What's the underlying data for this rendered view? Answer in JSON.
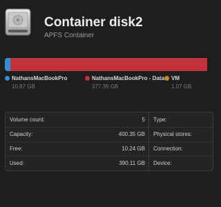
{
  "header": {
    "title": "Container disk2",
    "subtitle": "APFS Container",
    "icon": "hard-drive-icon"
  },
  "usage": {
    "segments": [
      {
        "name": "NathansMacBookPro",
        "size": "10.87 GB",
        "color": "#2f8fd6",
        "fraction": 0.027
      },
      {
        "name": "NathansMacBookPro - Data",
        "size": "377.39 GB",
        "color": "#c1323b",
        "fraction": 0.943
      },
      {
        "name": "VM",
        "size": "1.07 GB",
        "color": "#c88a2c",
        "fraction": 0.003
      }
    ]
  },
  "info": {
    "rows": [
      {
        "label": "Volume count:",
        "value": "5",
        "right_label": "Type:"
      },
      {
        "label": "Capacity:",
        "value": "400.35 GB",
        "right_label": "Physical stores:"
      },
      {
        "label": "Free:",
        "value": "10.24 GB",
        "right_label": "Connection:"
      },
      {
        "label": "Used:",
        "value": "390.11 GB",
        "right_label": "Device:"
      }
    ]
  }
}
